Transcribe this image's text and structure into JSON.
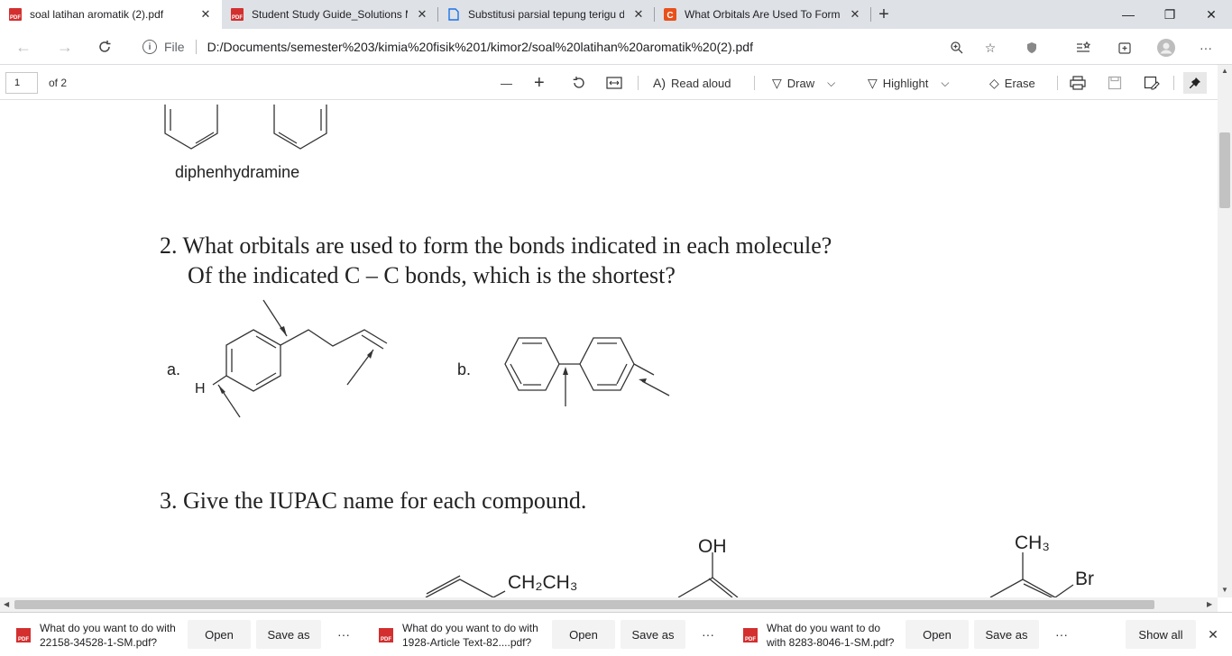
{
  "tabs": [
    {
      "title": "soal latihan aromatik (2).pdf",
      "icon": "pdf-icon",
      "active": true
    },
    {
      "title": "Student Study Guide_Solutions M",
      "icon": "pdf-icon",
      "active": false
    },
    {
      "title": "Substitusi parsial tepung terigu d",
      "icon": "page-icon",
      "active": false
    },
    {
      "title": "What Orbitals Are Used To Form",
      "icon": "c-icon",
      "active": false
    }
  ],
  "address": {
    "scheme": "File",
    "url": "D:/Documents/semester%203/kimia%20fisik%201/kimor2/soal%20latihan%20aromatik%20(2).pdf"
  },
  "pdf_toolbar": {
    "page_number": "1",
    "page_total": "of 2",
    "zoom_out": "—",
    "zoom_in": "+",
    "read_aloud": "Read aloud",
    "draw": "Draw",
    "highlight": "Highlight",
    "erase": "Erase"
  },
  "document": {
    "caption": "diphenhydramine",
    "q2_line1": "2. What orbitals are used to form the bonds indicated in each molecule?",
    "q2_line2": "Of the indicated C – C bonds, which is the shortest?",
    "label_a": "a.",
    "label_h": "H",
    "label_b": "b.",
    "q3": "3. Give the IUPAC name for each compound.",
    "label_ch2ch3": "CH₂CH₃",
    "label_oh": "OH",
    "label_ch3": "CH₃",
    "label_br": "Br"
  },
  "downloads": [
    {
      "line1": "What do you want to do with",
      "line2": "22158-34528-1-SM.pdf?",
      "open": "Open",
      "save": "Save as",
      "more": "···"
    },
    {
      "line1": "What do you want to do with",
      "line2": "1928-Article Text-82....pdf?",
      "open": "Open",
      "save": "Save as",
      "more": "···"
    },
    {
      "line1": "What do you want to do",
      "line2": "with 8283-8046-1-SM.pdf?",
      "open": "Open",
      "save": "Save as",
      "more": "···"
    }
  ],
  "show_all": "Show all"
}
